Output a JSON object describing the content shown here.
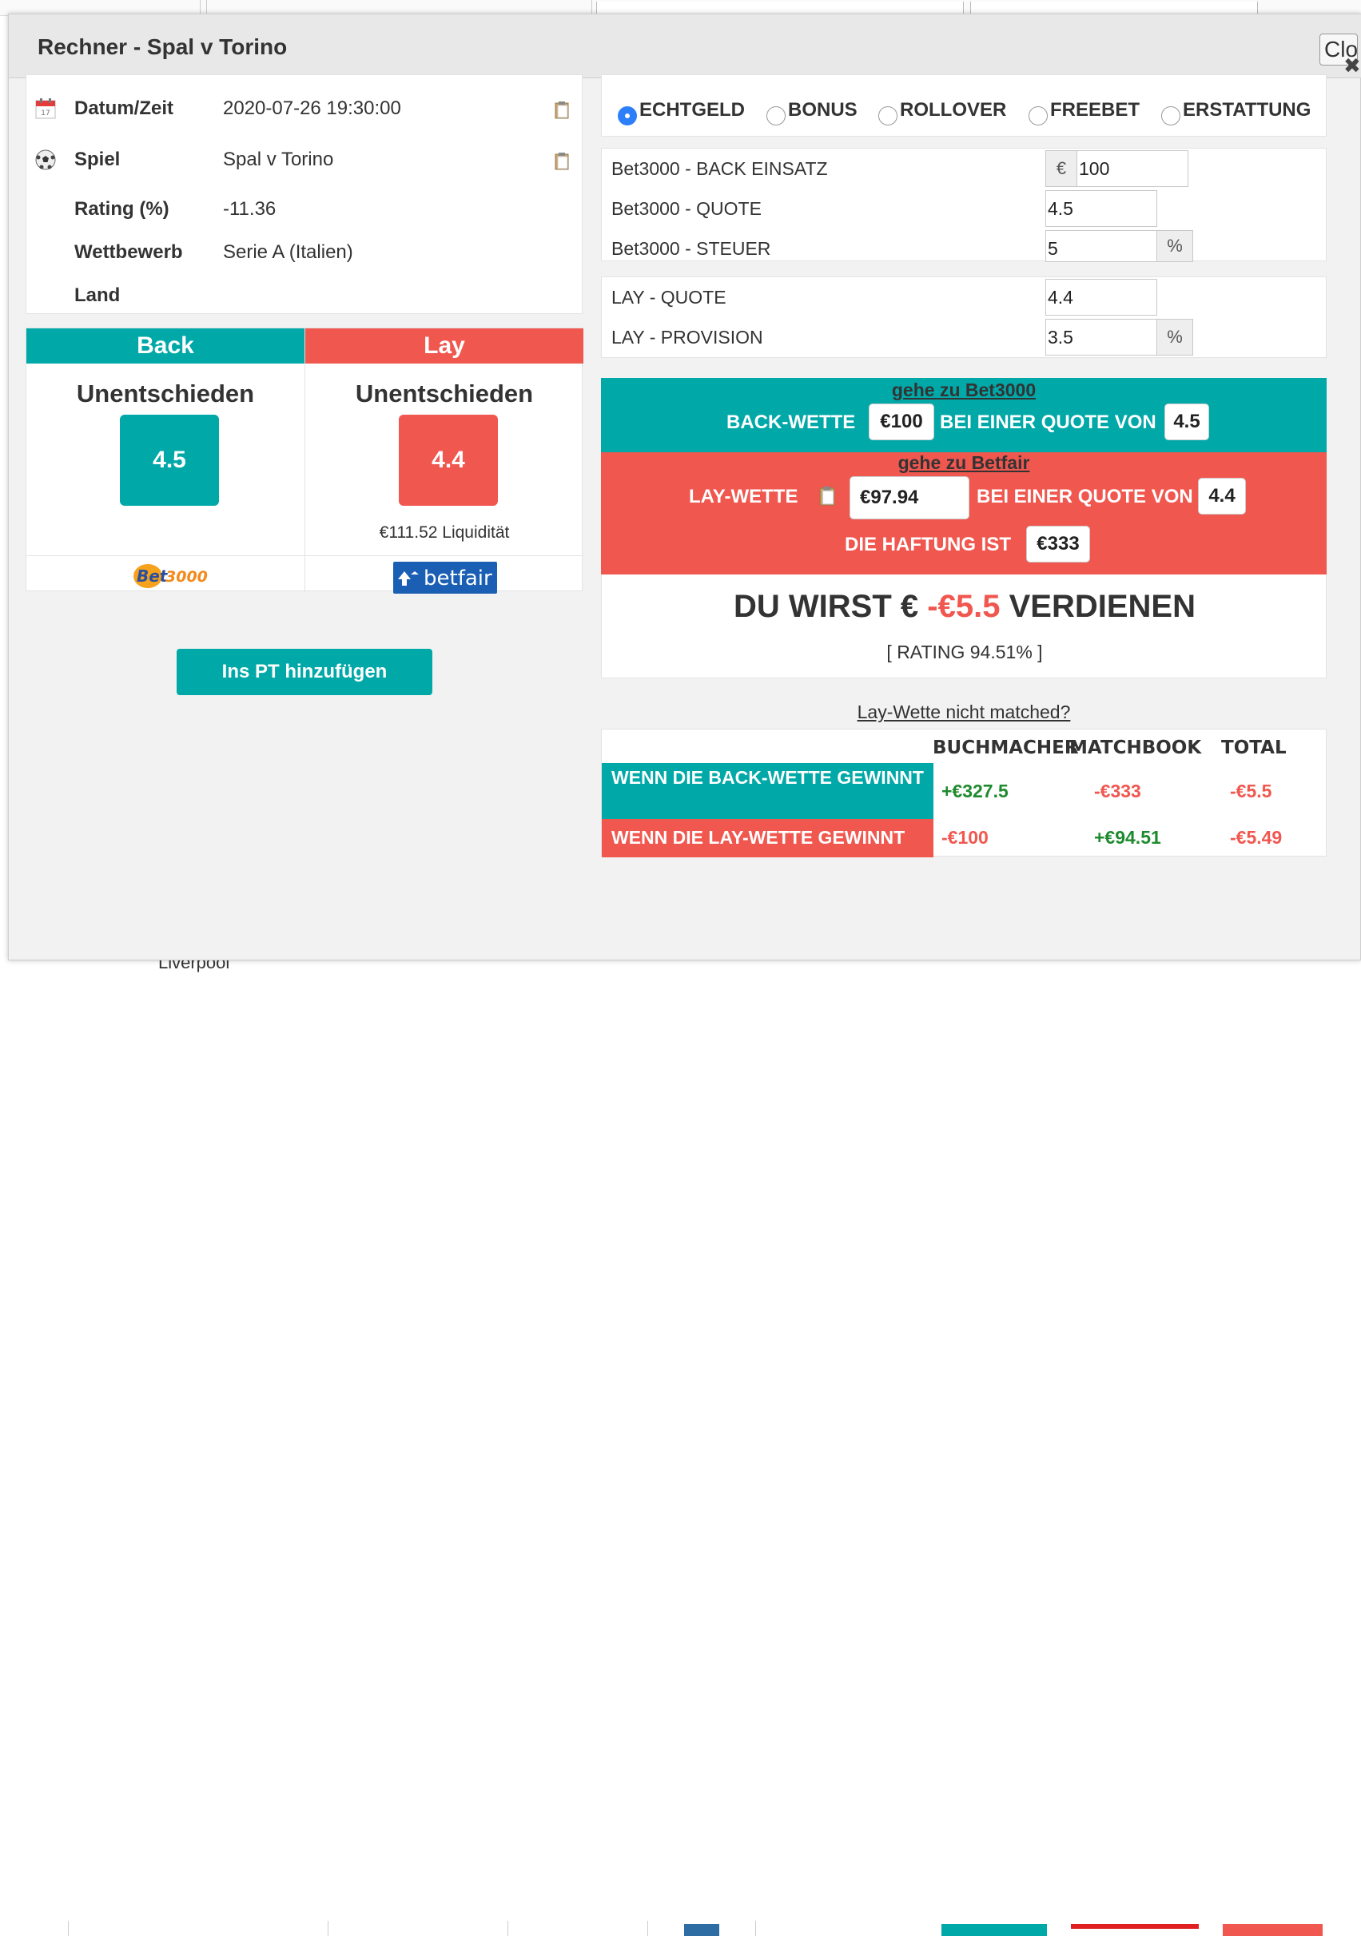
{
  "background": {
    "partial_text": "Liverpool"
  },
  "modal": {
    "title": "Rechner - Spal v Torino",
    "close_label": "Clo",
    "close_x": "✖"
  },
  "info": {
    "rows": [
      {
        "label": "Datum/Zeit",
        "value": "2020-07-26 19:30:00",
        "icon": "calendar-icon"
      },
      {
        "label": "Spiel",
        "value": "Spal v Torino",
        "icon": "soccer-ball-icon"
      },
      {
        "label": "Rating (%)",
        "value": "-11.36"
      },
      {
        "label": "Wettbewerb",
        "value": "Serie A (Italien)"
      },
      {
        "label": "Land",
        "value": ""
      }
    ]
  },
  "back_lay": {
    "back_header": "Back",
    "lay_header": "Lay",
    "back_outcome": "Unentschieden",
    "lay_outcome": "Unentschieden",
    "back_odds": "4.5",
    "lay_odds": "4.4",
    "lay_liquidity": "€111.52 Liquidität",
    "back_logo": {
      "part1": "Bet",
      "part2": "3000"
    },
    "lay_logo": "betfair",
    "colors": {
      "back": "#00a8a8",
      "lay": "#f0574f"
    }
  },
  "add_pt_label": "Ins PT hinzufügen",
  "bet_types": {
    "options": [
      "ECHTGELD",
      "BONUS",
      "ROLLOVER",
      "FREEBET",
      "ERSTATTUNG"
    ],
    "selected": "ECHTGELD"
  },
  "fields": {
    "back_stake_label": "Bet3000 - BACK EINSATZ",
    "back_stake_currency": "€",
    "back_stake_value": "100",
    "back_odds_label": "Bet3000 - QUOTE",
    "back_odds_value": "4.5",
    "back_tax_label": "Bet3000 - STEUER",
    "back_tax_value": "5",
    "percent": "%",
    "lay_odds_label": "LAY - QUOTE",
    "lay_odds_value": "4.4",
    "lay_commission_label": "LAY - PROVISION",
    "lay_commission_value": "3.5"
  },
  "instructions": {
    "back_link": "gehe zu Bet3000",
    "back_wette": "BACK-WETTE",
    "back_stake": "€100",
    "at_odds": "BEI EINER QUOTE VON",
    "back_odds": "4.5",
    "lay_link": "gehe zu Betfair",
    "lay_wette": "LAY-WETTE",
    "lay_stake": "€97.94",
    "lay_odds": "4.4",
    "liability_label": "DIE HAFTUNG IST",
    "liability_value": "€333"
  },
  "result": {
    "prefix": "DU WIRST €",
    "amount": "-€5.5",
    "suffix": "VERDIENEN",
    "rating": "[ RATING 94.51% ]"
  },
  "unmatched_link": "Lay-Wette nicht matched?",
  "outcome_table": {
    "headers": [
      "BUCHMACHER",
      "MATCHBOOK",
      "TOTAL"
    ],
    "rows": [
      {
        "label": "WENN DIE BACK-WETTE GEWINNT",
        "bookmaker": "+€327.5",
        "matchbook": "-€333",
        "total": "-€5.5"
      },
      {
        "label": "WENN DIE LAY-WETTE GEWINNT",
        "bookmaker": "-€100",
        "matchbook": "+€94.51",
        "total": "-€5.49"
      }
    ]
  }
}
